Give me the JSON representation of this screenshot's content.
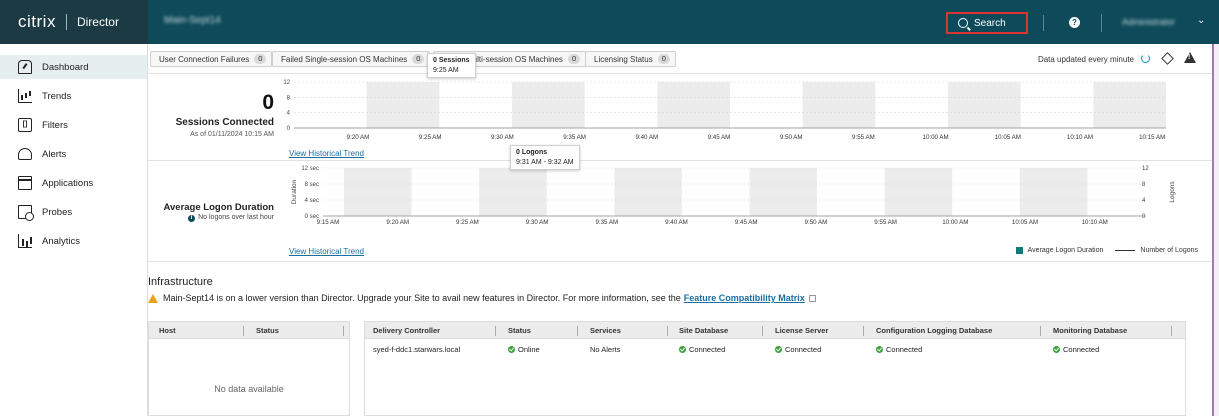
{
  "topbar": {
    "brand_logo": "citrix",
    "brand_app": "Director",
    "site_name": "Main-Sept14",
    "search_label": "Search",
    "help_label": "?",
    "user_name": "Administrator",
    "user_chevron": "⌄"
  },
  "sidebar": {
    "items": [
      {
        "label": "Dashboard",
        "icon": "dashboard-icon",
        "active": true
      },
      {
        "label": "Trends",
        "icon": "trends-icon"
      },
      {
        "label": "Filters",
        "icon": "filters-icon",
        "glyph": "[]"
      },
      {
        "label": "Alerts",
        "icon": "bell-icon"
      },
      {
        "label": "Applications",
        "icon": "applications-icon"
      },
      {
        "label": "Probes",
        "icon": "probes-icon"
      },
      {
        "label": "Analytics",
        "icon": "analytics-icon"
      }
    ]
  },
  "filters": {
    "chips": [
      {
        "label": "User Connection Failures",
        "count": "0"
      },
      {
        "label": "Failed Single-session OS Machines",
        "count": "0"
      },
      {
        "label": "Failed Multi-session OS Machines",
        "count": "0"
      },
      {
        "label": "Licensing Status",
        "count": "0"
      }
    ],
    "data_updated": "Data updated every minute"
  },
  "sessions": {
    "value": "0",
    "label": "Sessions Connected",
    "as_of": "As of 01/11/2024 10:15 AM",
    "link": "View Historical Trend",
    "y_ticks": [
      "12",
      "8",
      "4",
      "0"
    ],
    "x_ticks": [
      "9:20 AM",
      "9:25 AM",
      "9:30 AM",
      "9:35 AM",
      "9:40 AM",
      "9:45 AM",
      "9:50 AM",
      "9:55 AM",
      "10:00 AM",
      "10:05 AM",
      "10:10 AM",
      "10:15 AM"
    ],
    "tooltip": {
      "title": "0 Sessions",
      "time": "9:25 AM"
    }
  },
  "logon": {
    "title": "Average Logon Duration",
    "subtitle": "No logons over last hour",
    "info_glyph": "i",
    "link": "View Historical Trend",
    "y_left_label": "Duration",
    "y_right_label": "Logons",
    "y_left_ticks": [
      "12 sec",
      "8 sec",
      "4 sec",
      "0 sec"
    ],
    "y_right_ticks": [
      "12",
      "8",
      "4",
      "0"
    ],
    "x_ticks": [
      "9:15 AM",
      "9:20 AM",
      "9:25 AM",
      "9:30 AM",
      "9:35 AM",
      "9:40 AM",
      "9:45 AM",
      "9:50 AM",
      "9:55 AM",
      "10:00 AM",
      "10:05 AM",
      "10:10 AM"
    ],
    "tooltip": {
      "title": "0 Logons",
      "time": "9:31 AM - 9:32 AM"
    },
    "legend": {
      "duration": "Average Logon Duration",
      "count": "Number of Logons"
    },
    "accent": "#0f7a7a"
  },
  "infrastructure": {
    "title": "Infrastructure",
    "warning": "Main-Sept14 is on a lower version than Director. Upgrade your Site to avail new features in Director. For more information, see the",
    "warning_link": "Feature Compatibility Matrix",
    "host_table": {
      "columns": [
        "Host",
        "Status"
      ],
      "empty": "No data available"
    },
    "dc_table": {
      "columns": [
        "Delivery Controller",
        "Status",
        "Services",
        "Site Database",
        "License Server",
        "Configuration Logging Database",
        "Monitoring Database"
      ],
      "rows": [
        [
          "syed-f-ddc1.starwars.local",
          "Online",
          "No Alerts",
          "Connected",
          "Connected",
          "Connected",
          "Connected"
        ]
      ]
    }
  }
}
